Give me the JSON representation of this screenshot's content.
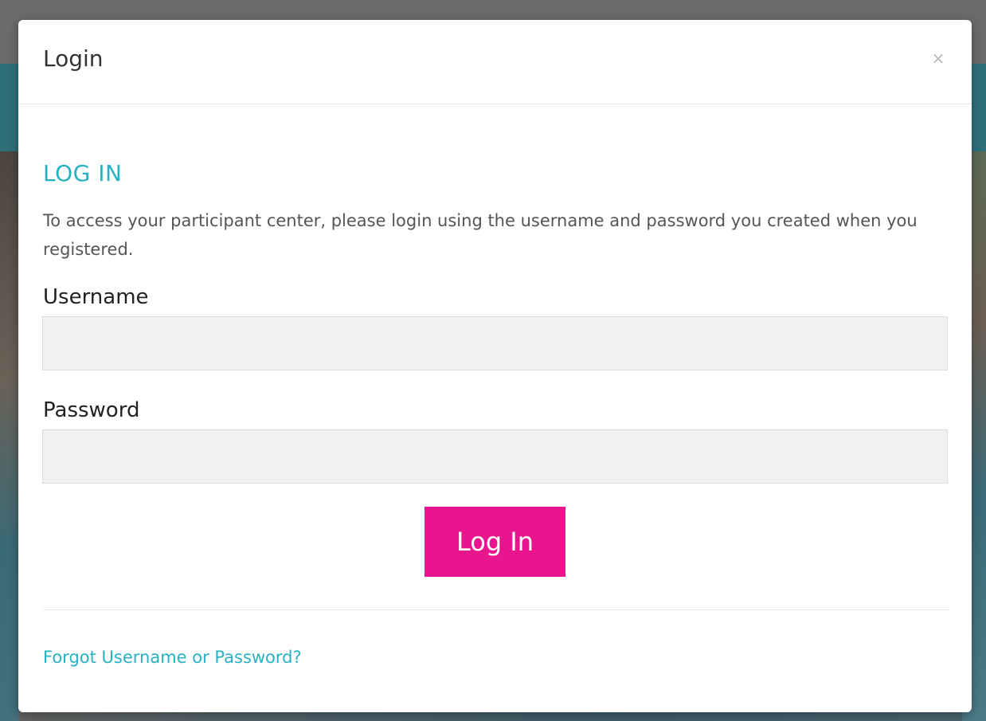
{
  "modal": {
    "title": "Login",
    "close_label": "×"
  },
  "login_section": {
    "heading": "LOG IN",
    "intro": "To access your participant center, please login using the username and password you created when you registered."
  },
  "form": {
    "username_label": "Username",
    "username_value": "",
    "password_label": "Password",
    "password_value": "",
    "submit_label": "Log In"
  },
  "footer": {
    "forgot_link": "Forgot Username or Password?"
  },
  "colors": {
    "accent_teal": "#27b2c4",
    "button_pink": "#e8158f",
    "input_bg": "#f1f1f1"
  }
}
